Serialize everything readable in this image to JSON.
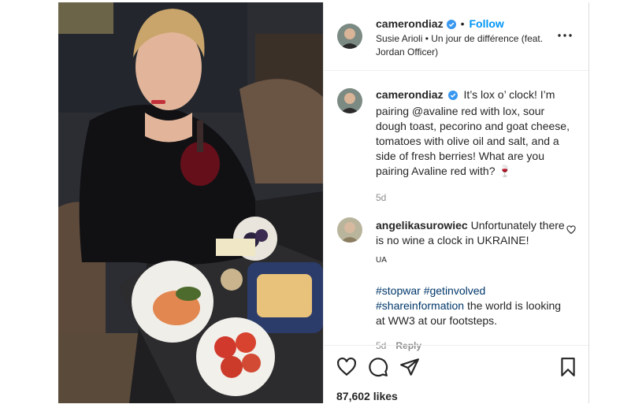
{
  "post": {
    "username": "camerondiaz",
    "follow_label": "Follow",
    "dot": "•",
    "audio": "Susie Arioli • Un jour de différence (feat. Jordan Officer)",
    "caption_text": "It’s lox o’ clock! I’m pairing @avaline red with lox, sour dough toast, pecorino and goat cheese, tomatoes with olive oil and salt, and a side of fresh berries! What are you pairing Avaline red with? 🍷",
    "caption_age": "5d",
    "likes": "87,602 likes"
  },
  "comment": {
    "username": "angelikasurowiec",
    "text": "Unfortunately there is no wine a clock in UKRAINE!",
    "flag": "UA",
    "hashtags": [
      "#stopwar",
      "#getinvolved",
      "#shareinformation"
    ],
    "tail": "the world is looking at WW3 at our footsteps.",
    "age": "5d",
    "reply_label": "Reply"
  },
  "icons": {
    "verified": "verified-badge-icon",
    "more": "more-options-icon",
    "like": "heart-icon",
    "comment": "comment-icon",
    "share": "paper-plane-icon",
    "save": "bookmark-icon"
  },
  "colors": {
    "accent": "#0095f6",
    "text": "#262626",
    "muted": "#8e8e8e",
    "hashtag": "#00376b"
  }
}
